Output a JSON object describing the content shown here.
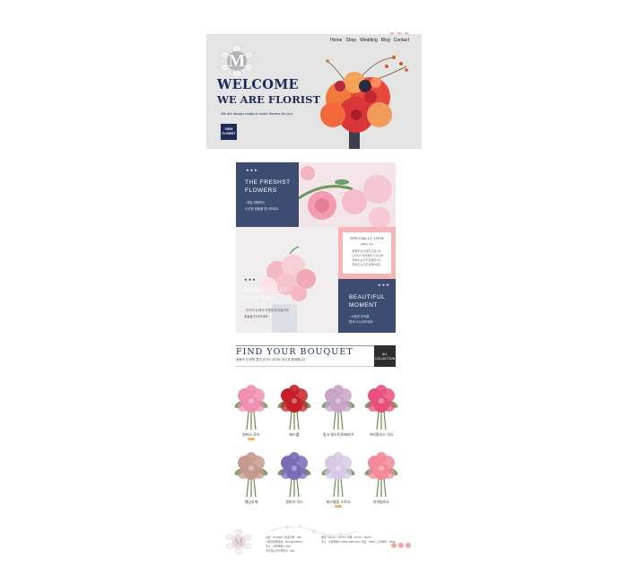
{
  "header": {
    "nav": [
      "Home",
      "Shop",
      "Wedding",
      "Blog",
      "Contact"
    ]
  },
  "hero": {
    "logo_letter": "M",
    "headline1": "WELCOME",
    "headline2": "WE ARE FLORIST",
    "tagline": "We are always ready to make flowers for you.",
    "button_line1": "VIEW",
    "button_line2": "FLORIST",
    "slide_count": 5,
    "active_slide": 5
  },
  "features": {
    "stars": "★★★",
    "freshest_line1": "THE FRESHST",
    "freshest_line2": "FLOWERS",
    "freshest_desc1": "- 매일 계획하는",
    "freshest_desc2": "신선한 꽃들을 만나보세요.",
    "special_line1": "SPECIALLY ITEM",
    "special_line2": "about you",
    "special_desc1": "특별을 당신에게 드립니다.",
    "special_desc2": "고객 마다 꽃다발을 디자인해",
    "special_desc3": "행복의 순간을 함께합니다.",
    "special_desc4": "행복한 순간을 함께하세요.",
    "crafted_line1": "BEAUTIFULLY",
    "crafted_line2": "CRAFTED",
    "crafted_desc1": "- 우리의 손에서 아름답게 만들어진",
    "crafted_desc2": "꽃들을 만나보세요.",
    "moment_line1": "BEAUTIFUL",
    "moment_line2": "MOMENT",
    "moment_desc1": "- 소중한 추억을",
    "moment_desc2": "함께 나누어보세요."
  },
  "find": {
    "title": "FIND YOUR BOUQUET",
    "subtitle": "동봉의 단 한번 뿐인 순간도 우리는 당신과 함께합니다.",
    "all_line1": "ALL",
    "all_line2": "COLLECTION"
  },
  "products": [
    {
      "name": "핀타스 로즈",
      "badge": true,
      "color": "#f08fb0"
    },
    {
      "name": "레드롤",
      "badge": false,
      "color": "#c4202a"
    },
    {
      "name": "핑크 말스트로메리아",
      "badge": false,
      "color": "#c9a3c8"
    },
    {
      "name": "아마릴리스 믹스",
      "badge": false,
      "color": "#e8507a"
    },
    {
      "name": "웨딩부케",
      "badge": false,
      "color": "#c79a8e"
    },
    {
      "name": "얼리브 믹스",
      "badge": false,
      "color": "#7b6ab8"
    },
    {
      "name": "퍼스텔및 스토크",
      "badge": true,
      "color": "#d8c9e6"
    },
    {
      "name": "아마릴리스",
      "badge": false,
      "color": "#f28a9b"
    }
  ],
  "footer": {
    "logo_letter": "M",
    "col1": [
      "상호 : 00 0000 | 대표자명 : 000",
      "사업자등록번호 : 000-00-00000",
      "주소 : 서울특별시 000",
      "개인정보관리책임자 : 000"
    ],
    "col2": [
      "평일 : 00:00 ~ 00:00 / 주말 : 00:00 ~ 00:00",
      "주소 : 서울특별시 0000 0000 000 | 대표 : 0000 | 고객센터 : 0000"
    ]
  },
  "colors": {
    "navy": "#1d2a55",
    "tile_navy": "#3d4d72",
    "pink": "#f7b5b5",
    "social": "#f2a7a7",
    "badge": "#f5b36a"
  },
  "icons": [
    "instagram-icon",
    "twitter-icon",
    "facebook-icon"
  ]
}
